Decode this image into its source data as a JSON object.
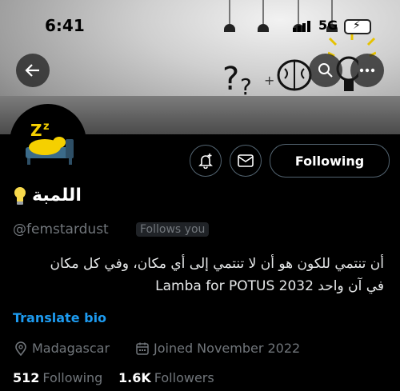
{
  "status_bar": {
    "time": "6:41",
    "network": "5G"
  },
  "icons": {
    "back": "arrow-left-icon",
    "search": "search-icon",
    "more": "more-icon",
    "notify": "bell-plus-icon",
    "message": "envelope-icon",
    "location": "location-pin-icon",
    "calendar": "calendar-icon",
    "avatar": "sleeping-emoji-icon",
    "name_emoji": "lightbulb-icon"
  },
  "profile": {
    "display_name": "اللمبة",
    "handle": "@femstardust",
    "follows_you": "Follows you",
    "bio_line1": "أن تنتمي للكون هو أن لا تنتمي إلى أي مكان، وفي كل مكان",
    "bio_line2": "في آن واحد Lamba for POTUS 2032",
    "translate": "Translate bio",
    "location": "Madagascar",
    "joined": "Joined November 2022",
    "following_count": "512",
    "following_label": "Following",
    "followers_count": "1.6K",
    "followers_label": "Followers"
  },
  "buttons": {
    "follow_state": "Following"
  },
  "colors": {
    "accent": "#1d9bf0",
    "muted": "#71767b",
    "text": "#e7e9ea",
    "background": "#000000"
  }
}
